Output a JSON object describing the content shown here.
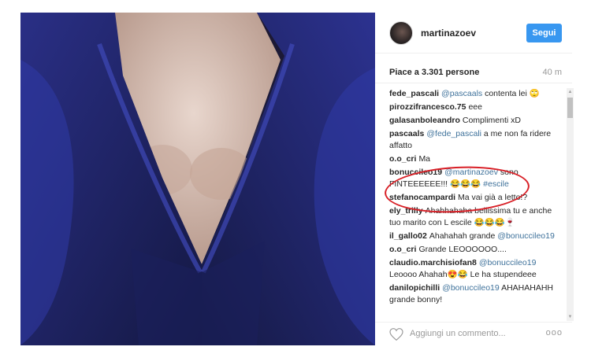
{
  "post": {
    "username": "martinazoev",
    "follow_label": "Segui",
    "likes_text": "Piace a 3.301 persone",
    "time_text": "40 m"
  },
  "comments": [
    {
      "user": "fede_pascali",
      "mention": "@pascaals",
      "text": "contenta lei 🙄"
    },
    {
      "user": "pirozzifrancesco.75",
      "text": "eee"
    },
    {
      "user": "galasanboleandro",
      "text": "Complimenti xD"
    },
    {
      "user": "pascaals",
      "mention": "@fede_pascali",
      "text": "a me non fa ridere affatto"
    },
    {
      "user": "o.o_cri",
      "text": "Ma"
    },
    {
      "user": "bonuccileo19",
      "mention": "@martinazoev",
      "text": "sono FINTEEEEEE!!! 😂😂😂",
      "tag": "#escile"
    },
    {
      "user": "stefanocampardi",
      "text": "Ma vai già a letto!?"
    },
    {
      "user": "ely_trilly",
      "text": "Ahahhahaha bellissima tu e anche tuo marito con L escile 😂😂😂🍷"
    },
    {
      "user": "il_gallo02",
      "text": "Ahahahah grande",
      "mention_after": "@bonuccileo19"
    },
    {
      "user": "o.o_cri",
      "text": "Grande LEOOOOOO...."
    },
    {
      "user": "claudio.marchisiofan8",
      "mention": "@bonuccileo19",
      "text": "Leoooo Ahahah😍😂 Le ha stupendeee"
    },
    {
      "user": "danilopichilli",
      "mention": "@bonuccileo19",
      "text": "AHAHAHAHH grande bonny!"
    }
  ],
  "footer": {
    "comment_placeholder": "Aggiungi un commento...",
    "more_label": "ooo"
  },
  "icons": {
    "heart": "heart-icon",
    "more": "more-options-icon",
    "scroll_up": "scroll-up-arrow",
    "scroll_down": "scroll-down-arrow"
  },
  "colors": {
    "follow_button": "#3897f0",
    "link": "#3f729b",
    "annotation": "#d81f26",
    "dress": "#1c1d52"
  }
}
